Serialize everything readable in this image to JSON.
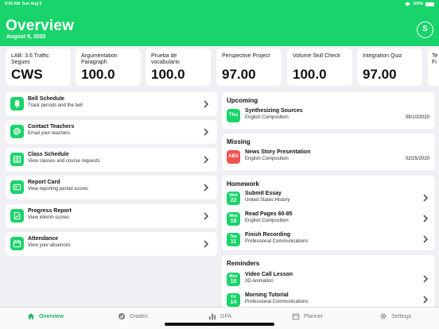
{
  "status_bar": {
    "time": "9:50 AM",
    "date": "Sun Aug 9",
    "battery": "100%"
  },
  "header": {
    "title": "Overview",
    "date": "August 9, 2020",
    "avatar_initial": "S"
  },
  "grades": [
    {
      "name": "LAB: 3.6 Traffic Segues",
      "value": "CWS"
    },
    {
      "name": "Argumentation Paragraph",
      "value": "100.0"
    },
    {
      "name": "Prueba de vocabulario",
      "value": "100.0"
    },
    {
      "name": "Perspective Project",
      "value": "97.00"
    },
    {
      "name": "Volume Skill Check",
      "value": "100.0"
    },
    {
      "name": "Integration Quiz",
      "value": "97.00"
    },
    {
      "name": "Te Fi",
      "value": ""
    }
  ],
  "quick_links": [
    {
      "title": "Bell Schedule",
      "subtitle": "Track periods and the bell",
      "icon": "bell-icon"
    },
    {
      "title": "Contact Teachers",
      "subtitle": "Email your teachers",
      "icon": "at-icon"
    },
    {
      "title": "Class Schedule",
      "subtitle": "View classes and course requests",
      "icon": "schedule-icon"
    },
    {
      "title": "Report Card",
      "subtitle": "View reporting period scores",
      "icon": "report-card-icon"
    },
    {
      "title": "Progress Report",
      "subtitle": "View interim scores",
      "icon": "progress-report-icon"
    },
    {
      "title": "Attendance",
      "subtitle": "View your absences",
      "icon": "calendar-icon"
    }
  ],
  "upcoming": {
    "heading": "Upcoming",
    "items": [
      {
        "badge": "Thu",
        "title": "Synthesizing Sources",
        "course": "English Composition",
        "date": "09/10/2020"
      }
    ]
  },
  "missing": {
    "heading": "Missing",
    "items": [
      {
        "badge": "ABS",
        "title": "News Story Presentation",
        "course": "English Composition",
        "date": "02/25/2020"
      }
    ]
  },
  "homework": {
    "heading": "Homework",
    "items": [
      {
        "day": "Wed",
        "num": "22",
        "title": "Submit Essay",
        "course": "United States History"
      },
      {
        "day": "Mon",
        "num": "10",
        "title": "Read Pages 60-85",
        "course": "English Composition"
      },
      {
        "day": "Tue",
        "num": "11",
        "title": "Finish Recording",
        "course": "Professional Communications"
      }
    ]
  },
  "reminders": {
    "heading": "Reminders",
    "items": [
      {
        "day": "Mon",
        "num": "10",
        "title": "Video Call Lesson",
        "course": "3D Animation"
      },
      {
        "day": "Fri",
        "num": "14",
        "title": "Morning Tutorial",
        "course": "Professional Communications"
      }
    ]
  },
  "tabs": [
    {
      "label": "Overview",
      "icon": "home-icon"
    },
    {
      "label": "Grades",
      "icon": "grades-icon"
    },
    {
      "label": "GPA",
      "icon": "bar-chart-icon"
    },
    {
      "label": "Planner",
      "icon": "planner-icon"
    },
    {
      "label": "Settings",
      "icon": "gear-icon"
    }
  ],
  "colors": {
    "accent": "#19d46a",
    "missing": "#f0524f",
    "background": "#efeff4"
  }
}
